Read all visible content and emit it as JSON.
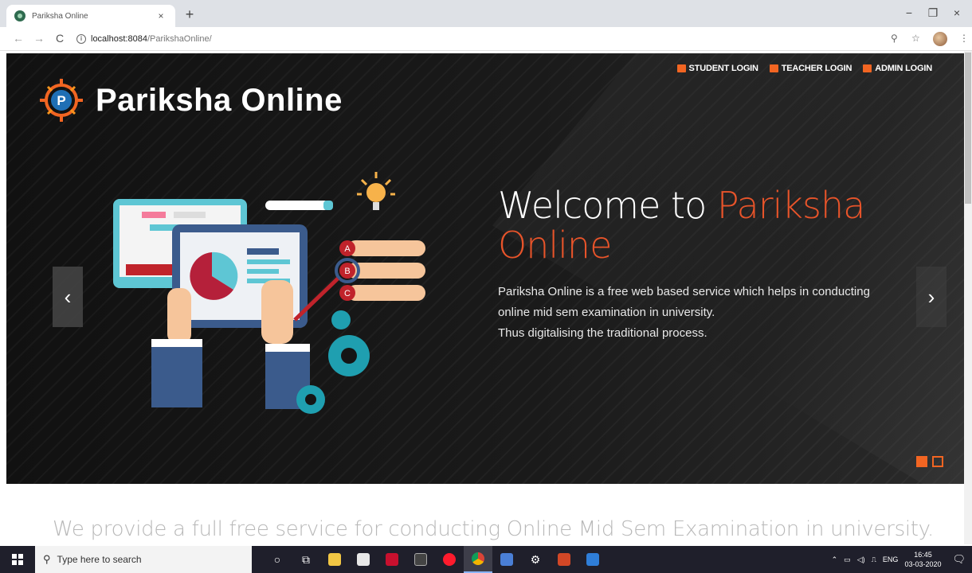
{
  "browser": {
    "tab_title": "Pariksha Online",
    "tab_close": "×",
    "new_tab": "+",
    "url_host": "localhost:8084",
    "url_path": "/ParikshaOnline/",
    "window_controls": {
      "minimize": "−",
      "maximize": "❐",
      "close": "×"
    },
    "nav": {
      "back": "←",
      "forward": "→",
      "reload": "C"
    }
  },
  "site": {
    "logo_text": "Pariksha Online",
    "logo_letter": "P",
    "top_links": [
      {
        "label": "STUDENT LOGIN"
      },
      {
        "label": "TEACHER LOGIN"
      },
      {
        "label": "ADMIN LOGIN"
      }
    ],
    "hero": {
      "welcome_prefix": "Welcome to ",
      "welcome_accent": "Pariksha Online",
      "description_lines": [
        "Pariksha Online is a free web based service which helps in conducting",
        "online mid sem examination in university.",
        "Thus digitalising the traditional process."
      ],
      "prev_label": "‹",
      "next_label": "›",
      "slide_count": 2,
      "active_slide": 1,
      "options": [
        "A",
        "B",
        "C"
      ]
    },
    "tagline": "We provide a full free service for conducting Online Mid Sem Examination in university."
  },
  "taskbar": {
    "search_placeholder": "Type here to search",
    "tray_lang": "ENG",
    "time": "16:45",
    "date": "03-03-2020"
  },
  "colors": {
    "accent": "#f26522",
    "welcome_accent": "#e8542a",
    "hero_bg": "#151515"
  }
}
